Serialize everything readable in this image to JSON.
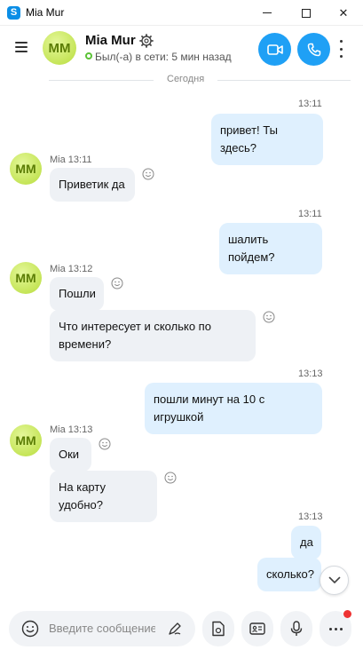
{
  "window": {
    "title": "Mia Mur",
    "app_icon_letter": "S",
    "minimize_glyph": "—",
    "maximize_glyph": "□",
    "close_glyph": "✕"
  },
  "header": {
    "avatar_initials": "MM",
    "name": "Mia Mur",
    "status": "Был(-а) в сети: 5 мин назад",
    "status_color": "#5bc236",
    "accent": "#1fa0f5"
  },
  "chat": {
    "day_separator": "Сегодня",
    "messages": [
      {
        "dir": "out",
        "time": "13:11",
        "text": "привет! Ты здесь?"
      },
      {
        "dir": "in",
        "sender": "Mia",
        "time": "13:11",
        "meta": "Mia 13:11",
        "text": "Приветик да"
      },
      {
        "dir": "out",
        "time": "13:11",
        "text": "шалить пойдем?"
      },
      {
        "dir": "in",
        "sender": "Mia",
        "time": "13:12",
        "meta": "Mia 13:12",
        "text": "Пошли"
      },
      {
        "dir": "in",
        "text": "Что интересует и сколько по времени?"
      },
      {
        "dir": "out",
        "time": "13:13",
        "text": "пошли минут на 10 с игрушкой"
      },
      {
        "dir": "in",
        "sender": "Mia",
        "time": "13:13",
        "meta": "Mia 13:13",
        "text": "Оки"
      },
      {
        "dir": "in",
        "text": "На карту удобно?"
      },
      {
        "dir": "out",
        "time": "13:13",
        "text": "да"
      },
      {
        "dir": "out",
        "text": "сколько?"
      }
    ]
  },
  "composer": {
    "placeholder": "Введите сообщение",
    "has_notification": true
  },
  "icons": [
    "app-icon",
    "gear-icon",
    "video-call-icon",
    "phone-icon",
    "more-vertical-icon",
    "menu-icon",
    "smiley-icon",
    "chevron-down-icon",
    "emoji-icon",
    "pen-icon",
    "file-icon",
    "contact-card-icon",
    "mic-icon",
    "more-horizontal-icon"
  ]
}
